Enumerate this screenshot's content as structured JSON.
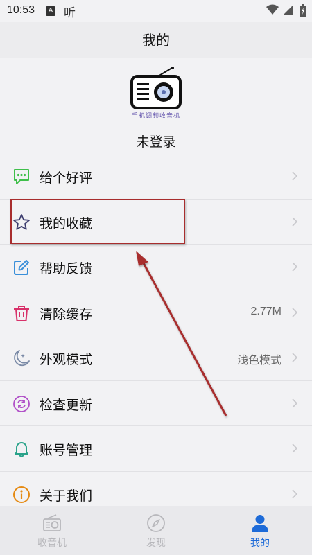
{
  "status_bar": {
    "time": "10:53",
    "app_badge": "A",
    "app_glyph": "听"
  },
  "header": {
    "title": "我的"
  },
  "profile": {
    "logo_caption": "手机调频收音机",
    "login_status": "未登录"
  },
  "menu": [
    {
      "label": "给个好评",
      "value": "",
      "icon": "message-dots-icon",
      "color": "#3fbf4a"
    },
    {
      "label": "我的收藏",
      "value": "",
      "icon": "star-outline-icon",
      "color": "#3c3c6e"
    },
    {
      "label": "帮助反馈",
      "value": "",
      "icon": "edit-square-icon",
      "color": "#3a8fd9"
    },
    {
      "label": "清除缓存",
      "value": "2.77M",
      "icon": "trash-icon",
      "color": "#d8326a"
    },
    {
      "label": "外观模式",
      "value": "浅色模式",
      "icon": "moon-icon",
      "color": "#7a8aa6"
    },
    {
      "label": "检查更新",
      "value": "",
      "icon": "refresh-circle-icon",
      "color": "#b04fc7"
    },
    {
      "label": "账号管理",
      "value": "",
      "icon": "bell-icon",
      "color": "#2aa38a"
    },
    {
      "label": "关于我们",
      "value": "",
      "icon": "info-circle-icon",
      "color": "#e58a12"
    }
  ],
  "tabs": [
    {
      "label": "收音机",
      "icon": "radio-icon",
      "active": false
    },
    {
      "label": "发现",
      "icon": "compass-icon",
      "active": false
    },
    {
      "label": "我的",
      "icon": "user-icon",
      "active": true
    }
  ],
  "colors": {
    "accent": "#1e6bd8",
    "annotation": "#a82d2d"
  }
}
